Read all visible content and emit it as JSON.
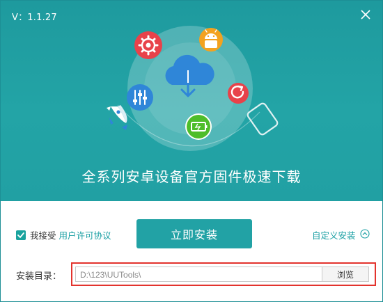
{
  "header": {
    "version": "V：1.1.27",
    "tagline": "全系列安卓设备官方固件极速下载"
  },
  "icons": {
    "close": "close-icon",
    "cloud": "cloud-download-icon",
    "settings": "gear-icon",
    "android": "android-icon",
    "refresh": "refresh-icon",
    "sliders": "sliders-icon",
    "battery": "battery-icon",
    "phone": "phone-icon",
    "rocket": "rocket-icon"
  },
  "colors": {
    "primary": "#22a2a5",
    "red_icon": "#e8424a",
    "orange_icon": "#f3a21f",
    "blue_icon": "#2f86d8",
    "green_icon": "#4ebd2a",
    "highlight_border": "#e3332d"
  },
  "agreement": {
    "checked": true,
    "label": "我接受",
    "link": "用户许可协议"
  },
  "install_button": "立即安装",
  "custom_install": "自定义安装",
  "directory": {
    "label": "安装目录：",
    "value": "D:\\123\\UUTools\\",
    "browse_label": "浏览"
  }
}
